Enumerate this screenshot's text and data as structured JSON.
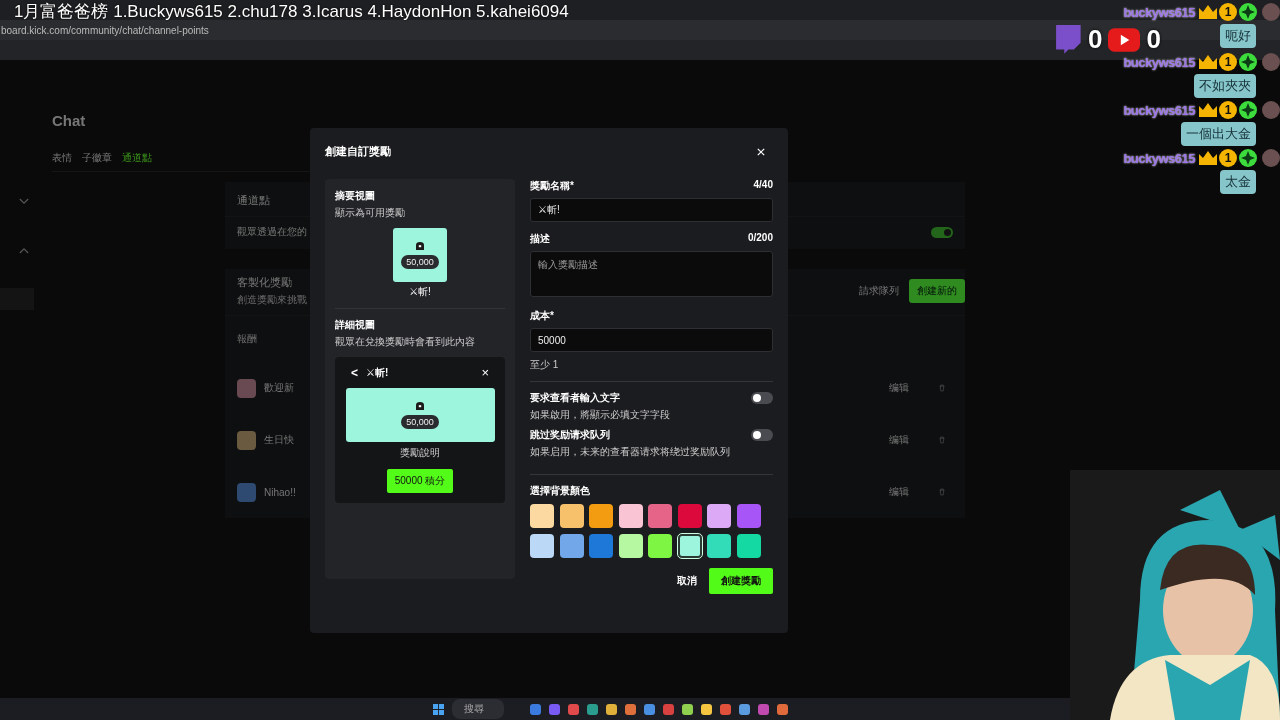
{
  "stream_overlay": {
    "leaderboard": "1月富爸爸榜  1.Buckyws615  2.chu178  3.Icarus  4.HaydonHon  5.kahei6094",
    "counters": [
      {
        "kind": "bubble",
        "count": "0"
      },
      {
        "kind": "play",
        "count": "0"
      }
    ]
  },
  "browser": {
    "url": "board.kick.com/community/chat/channel-points"
  },
  "page": {
    "title": "Chat",
    "tabs": [
      {
        "label": "表情",
        "selected": false
      },
      {
        "label": "子徽章",
        "selected": false
      },
      {
        "label": "通道點",
        "selected": true
      }
    ],
    "channel_points": {
      "title": "通道點",
      "description": "觀眾透過在您的",
      "enabled": true
    },
    "custom_rewards": {
      "title": "客製化獎勵",
      "subtitle": "創造獎勵來挑戰",
      "queue_button": "請求隊列",
      "create_button": "創建新的",
      "column": "報酬",
      "rows": [
        {
          "name": "歡迎新",
          "color": "#6a4a52",
          "edit": "编辑"
        },
        {
          "name": "生日快",
          "color": "#6a5a40",
          "edit": "编辑"
        },
        {
          "name": "Nihao!!",
          "color": "#2e4a70",
          "edit": "编辑"
        }
      ]
    }
  },
  "modal": {
    "title": "創建自訂獎勵",
    "summary": {
      "title": "摘要視圖",
      "subtitle": "顯示為可用獎勵",
      "cost": "50,000",
      "name": "⚔斬!"
    },
    "detail": {
      "title": "詳細視圖",
      "subtitle": "觀眾在兌換獎勵時會看到此內容",
      "back": "<",
      "name": "⚔斬!",
      "close": "×",
      "cost": "50,000",
      "description": "獎勵說明",
      "redeem_button": "50000 積分"
    },
    "name_field": {
      "label": "獎勵名稱*",
      "counter": "4/40",
      "value": "⚔斬!"
    },
    "description_field": {
      "label": "描述",
      "counter": "0/200",
      "placeholder": "輸入獎勵描述"
    },
    "cost_field": {
      "label": "成本*",
      "value": "50000",
      "hint": "至少 1"
    },
    "toggles": [
      {
        "label": "要求查看者輸入文字",
        "hint": "如果啟用，將顯示必填文字字段",
        "on": false
      },
      {
        "label": "跳过奖励请求队列",
        "hint": "如果启用，未来的查看器请求将绕过奖励队列",
        "on": false
      }
    ],
    "color_label": "選擇背景顏色",
    "colors": [
      {
        "color": "#fcd9a0",
        "selected": false
      },
      {
        "color": "#f7c06b",
        "selected": false
      },
      {
        "color": "#f39c12",
        "selected": false
      },
      {
        "color": "#f9c5d5",
        "selected": false
      },
      {
        "color": "#e56487",
        "selected": false
      },
      {
        "color": "#dc0a3c",
        "selected": false
      },
      {
        "color": "#dba9f5",
        "selected": false
      },
      {
        "color": "#a855f7",
        "selected": false
      },
      {
        "color": "#bcd8f7",
        "selected": false
      },
      {
        "color": "#72a7ea",
        "selected": false
      },
      {
        "color": "#1e78d8",
        "selected": false
      },
      {
        "color": "#b6f7a2",
        "selected": false
      },
      {
        "color": "#7ef542",
        "selected": false
      },
      {
        "color": "#9ef5de",
        "selected": true
      },
      {
        "color": "#33dcb8",
        "selected": false
      },
      {
        "color": "#14d9a3",
        "selected": false
      }
    ],
    "cancel_button": "取消",
    "create_button": "創建獎勵"
  },
  "chat": [
    {
      "user": "buckyws615",
      "rank": "1",
      "message": "呃好"
    },
    {
      "user": "buckyws615",
      "rank": "1",
      "message": "不如夾夾"
    },
    {
      "user": "buckyws615",
      "rank": "1",
      "message": "一個出大金"
    },
    {
      "user": "buckyws615",
      "rank": "1",
      "message": "太金"
    }
  ],
  "taskbar": {
    "search": "搜尋"
  }
}
